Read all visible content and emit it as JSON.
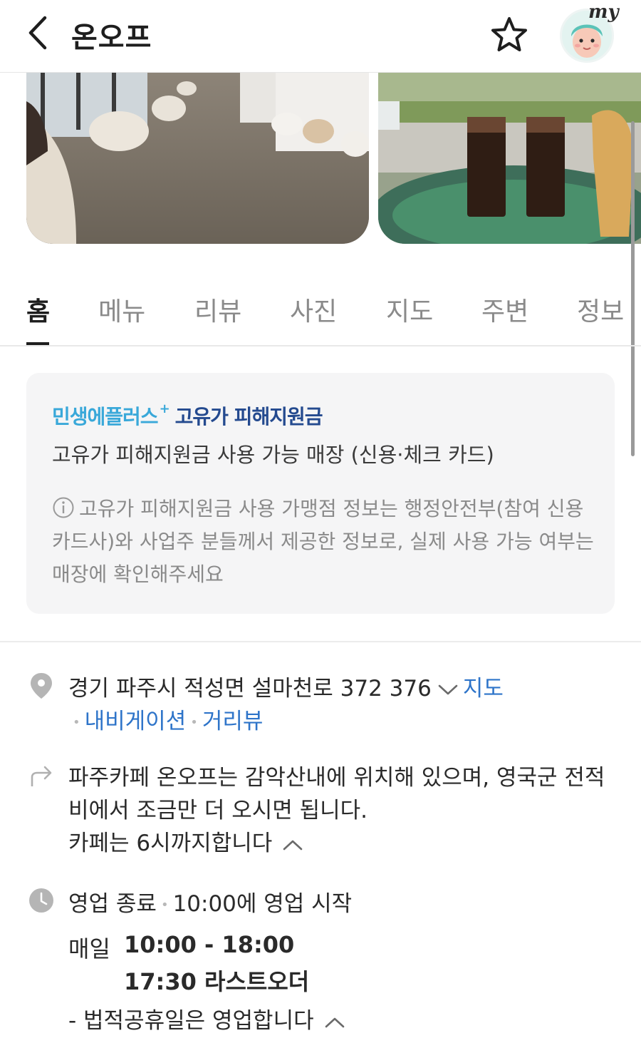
{
  "header": {
    "title": "온오프",
    "avatar_badge": "my"
  },
  "photos": [
    {
      "alt": "cafe-interior"
    },
    {
      "alt": "iced-coffee"
    }
  ],
  "tabs": [
    {
      "label": "홈",
      "active": true
    },
    {
      "label": "메뉴",
      "active": false
    },
    {
      "label": "리뷰",
      "active": false
    },
    {
      "label": "사진",
      "active": false
    },
    {
      "label": "지도",
      "active": false
    },
    {
      "label": "주변",
      "active": false
    },
    {
      "label": "정보",
      "active": false
    }
  ],
  "notice": {
    "brand": "민생에플러스",
    "plus_mark": "+",
    "fund": "고유가 피해지원금",
    "main_text": "고유가 피해지원금 사용 가능 매장 (신용·체크 카드)",
    "info_text": "고유가 피해지원금 사용 가맹점 정보는 행정안전부(참여 신용카드사)와 사업주 분들께서 제공한 정보로, 실제 사용 가능 여부는 매장에 확인해주세요"
  },
  "address": {
    "text": "경기 파주시 적성면 설마천로 372 376",
    "map_link": "지도",
    "navigation_link": "내비게이션",
    "street_view_link": "거리뷰"
  },
  "directions": {
    "text_line1": "파주카페 온오프는 감악산내에 위치해 있으며, 영국군 전적",
    "text_line2": "비에서 조금만 더 오시면 됩니다.",
    "text_line3": "카페는 6시까지합니다"
  },
  "hours": {
    "status": "영업 종료",
    "next_open": "10:00에 영업 시작",
    "day": "매일",
    "time_range": "10:00 - 18:00",
    "last_order": "17:30 라스트오더",
    "holiday_note": "- 법적공휴일은 영업합니다"
  },
  "colors": {
    "link": "#2e74c9",
    "brand": "#39a8d9",
    "fund": "#244a8f"
  }
}
